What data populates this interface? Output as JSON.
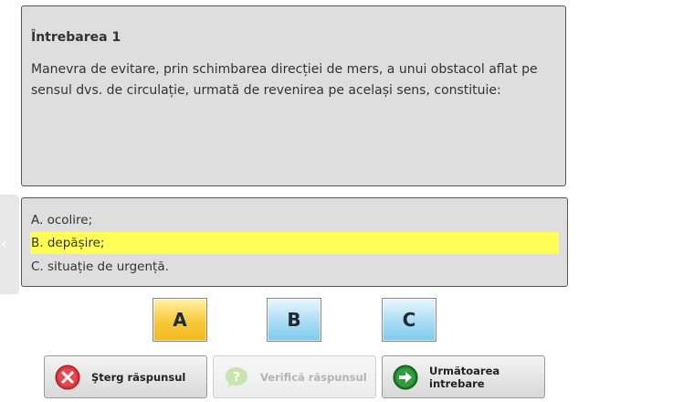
{
  "question": {
    "title": "Întrebarea 1",
    "text": "Manevra de evitare, prin schimbarea direcției de mers, a unui obstacol aflat pe sensul dvs. de circulație, urmată de revenirea pe același sens, constituie:"
  },
  "answers": [
    {
      "label": "A. ocolire;",
      "highlighted": false
    },
    {
      "label": "B. depășire;",
      "highlighted": true
    },
    {
      "label": "C. situație de urgență.",
      "highlighted": false
    }
  ],
  "answer_buttons": [
    {
      "letter": "A",
      "color": "yellow"
    },
    {
      "letter": "B",
      "color": "blue"
    },
    {
      "letter": "C",
      "color": "blue"
    }
  ],
  "actions": {
    "clear_label": "Şterg răspunsul",
    "verify_label": "Verifică răspunsul",
    "next_label": "Următoarea intrebare"
  },
  "side_tab": {
    "icon": "chevron-left-icon",
    "glyph": "‹"
  },
  "colors": {
    "highlight": "#ffff55",
    "panel_bg": "#dedede",
    "yellow_btn": "#f7c93a",
    "blue_btn": "#a9dcf3"
  }
}
